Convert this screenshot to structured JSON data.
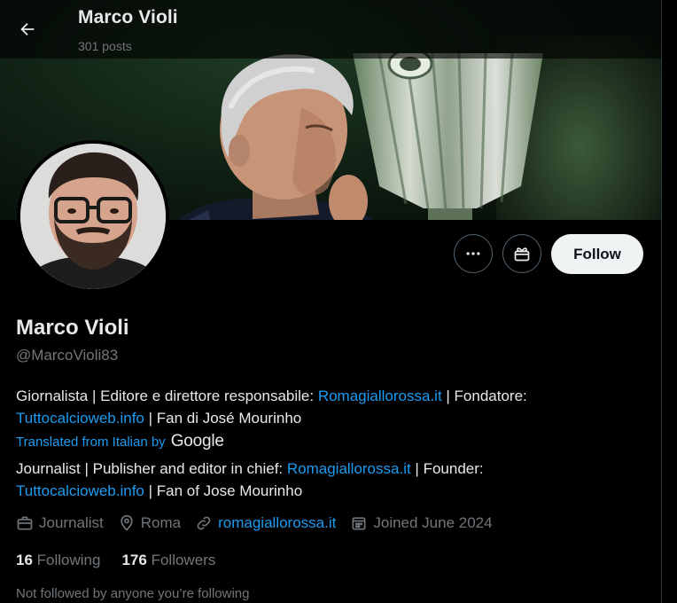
{
  "header": {
    "name": "Marco Violi",
    "posts": "301 posts"
  },
  "profile": {
    "display_name": "Marco Violi",
    "handle": "@MarcoVioli83",
    "bio_original": {
      "part1": "Giornalista | Editore e direttore responsabile: ",
      "link1": "Romagiallorossa.it",
      "part2": " | Fondatore: ",
      "link2": "Tuttocalcioweb.info",
      "part3": " | Fan di José Mourinho"
    },
    "translated_from": "Translated from Italian by",
    "translator_brand": "Google",
    "bio_translated": {
      "part1": "Journalist | Publisher and editor in chief: ",
      "link1": "Romagiallorossa.it",
      "part2": " | Founder: ",
      "link2": "Tuttocalcioweb.info",
      "part3": " | Fan of Jose Mourinho"
    },
    "meta": {
      "profession": "Journalist",
      "location": "Roma",
      "website": "romagiallorossa.it",
      "joined": "Joined June 2024"
    },
    "stats": {
      "following_count": "16",
      "following_label": "Following",
      "followers_count": "176",
      "followers_label": "Followers"
    },
    "not_followed_note": "Not followed by anyone you’re following"
  },
  "actions": {
    "follow_label": "Follow",
    "more_icon": "ellipsis-icon",
    "gift_icon": "gift-icon"
  },
  "colors": {
    "accent": "#1d9bf0",
    "background": "#000000",
    "text_primary": "#e7e9ea",
    "text_secondary": "#71767b",
    "follow_bg": "#eff3f4"
  }
}
